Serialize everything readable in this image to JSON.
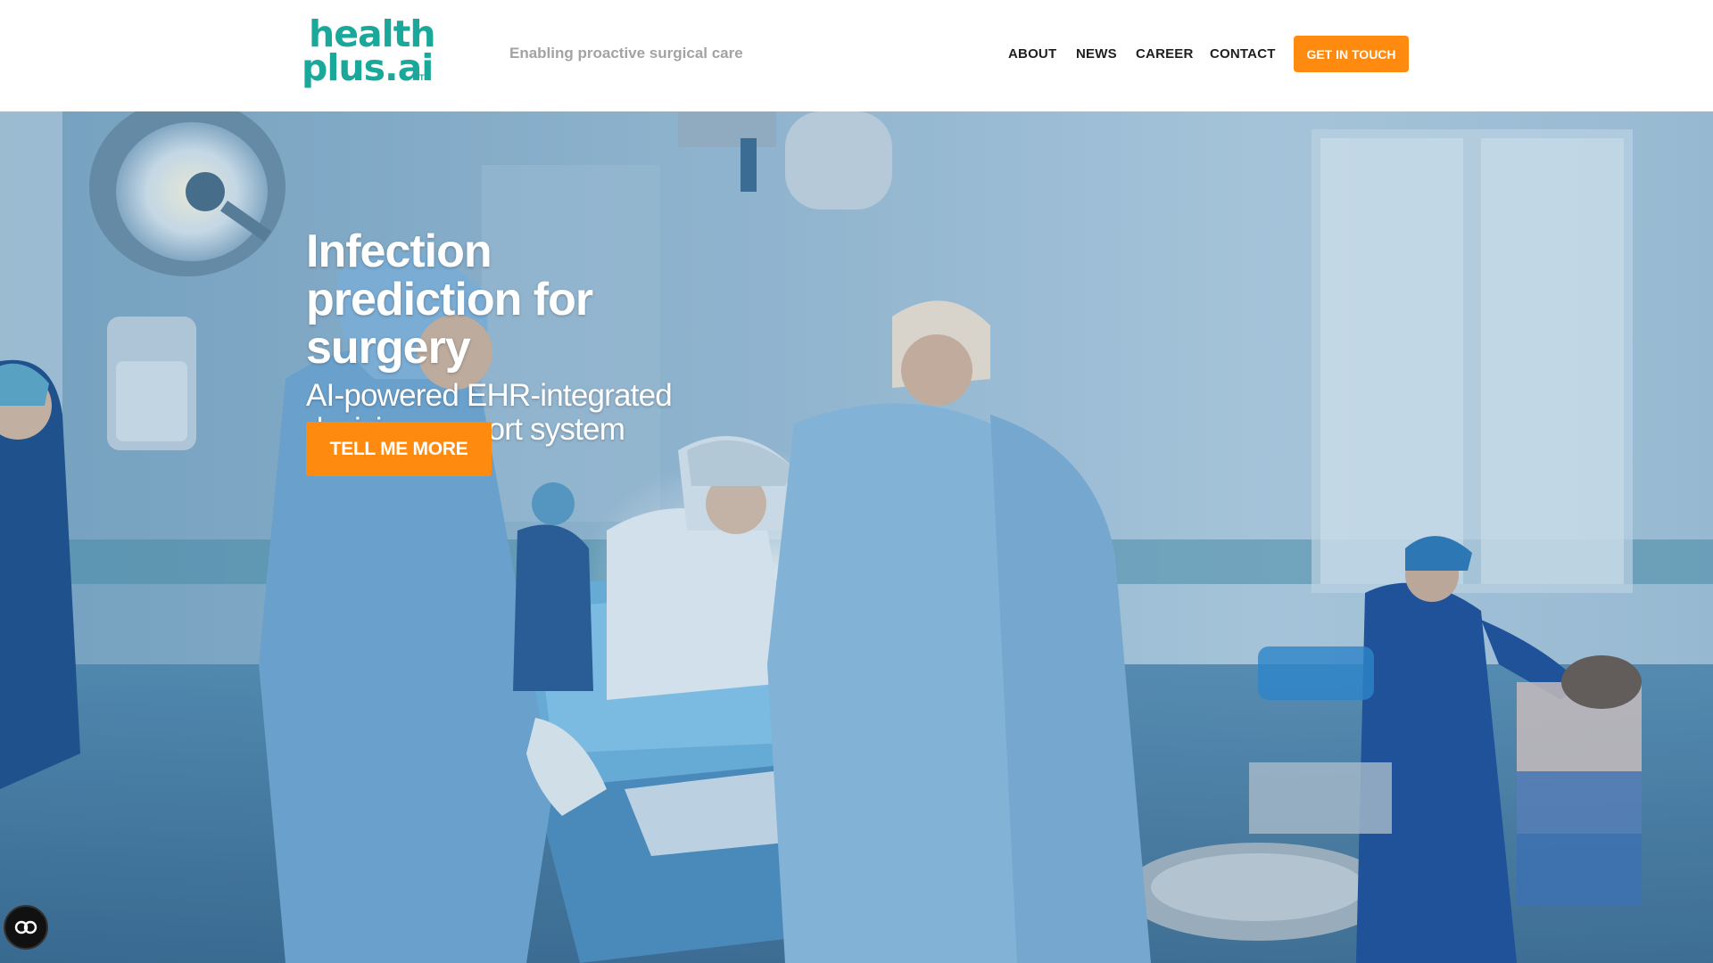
{
  "brand": {
    "logo_line1": "health",
    "logo_line2": "plus.ai",
    "logo_tm": "TM",
    "tagline": "Enabling proactive surgical care",
    "accent_color": "#1aa89a",
    "cta_color": "#ff8a10"
  },
  "nav": {
    "items": [
      {
        "label": "ABOUT"
      },
      {
        "label": "NEWS"
      },
      {
        "label": "CAREER"
      },
      {
        "label": "CONTACT"
      }
    ],
    "cta_label": "GET IN TOUCH"
  },
  "hero": {
    "headline": "Infection prediction for surgery",
    "subheadline": "AI-powered EHR-integrated decision support system",
    "button_label": "TELL ME MORE",
    "background_image": "operating room with surgeons in blue gowns"
  },
  "floating": {
    "icon": "accessibility-icon"
  }
}
